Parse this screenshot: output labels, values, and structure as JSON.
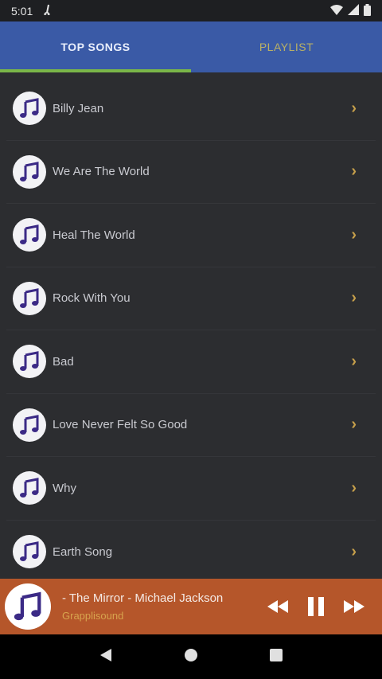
{
  "status": {
    "time": "5:01"
  },
  "tabs": [
    {
      "label": "TOP SONGS",
      "active": true
    },
    {
      "label": "PLAYLIST",
      "active": false
    }
  ],
  "songs": [
    {
      "title": "Billy Jean"
    },
    {
      "title": "We Are The World"
    },
    {
      "title": "Heal The World"
    },
    {
      "title": "Rock With You"
    },
    {
      "title": "Bad"
    },
    {
      "title": "Love Never Felt So Good"
    },
    {
      "title": "Why"
    },
    {
      "title": "Earth Song"
    }
  ],
  "player": {
    "title": "- The Mirror - Michael Jackson",
    "subtitle": "Grapplisound"
  },
  "colors": {
    "tab_bar": "#3a5aa6",
    "tab_indicator": "#7ab648",
    "player_bar": "#b5562a",
    "chevron": "#c7a04b"
  },
  "icons": {
    "song": "music-note-icon",
    "chevron": "chevron-right-icon",
    "rewind": "rewind-icon",
    "pause": "pause-icon",
    "forward": "fast-forward-icon",
    "back": "back-nav-icon",
    "home": "home-nav-icon",
    "recents": "recents-nav-icon"
  }
}
